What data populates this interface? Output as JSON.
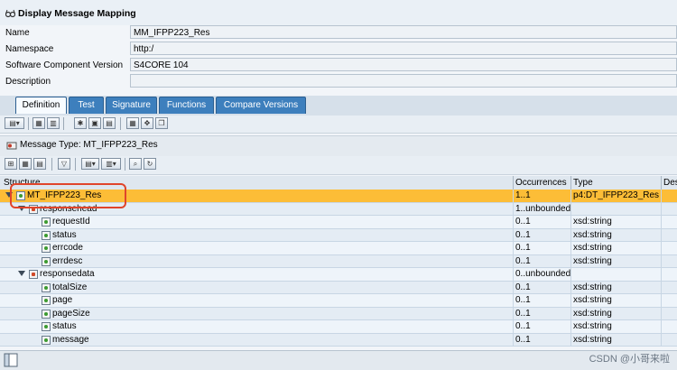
{
  "window": {
    "title": "Display Message Mapping"
  },
  "fields": [
    {
      "label": "Name",
      "value": "MM_IFPP223_Res"
    },
    {
      "label": "Namespace",
      "value": "http:/"
    },
    {
      "label": "Software Component Version",
      "value": "S4CORE 104"
    },
    {
      "label": "Description",
      "value": ""
    }
  ],
  "tabs": [
    "Definition",
    "Test",
    "Signature",
    "Functions",
    "Compare Versions"
  ],
  "message_type": {
    "label": "Message Type: MT_IFPP223_Res"
  },
  "grid": {
    "headers": {
      "structure": "Structure",
      "occurrences": "Occurrences",
      "type": "Type",
      "desc": "Des"
    },
    "rows": [
      {
        "name": "MT_IFPP223_Res",
        "occ": "1..1",
        "type": "p4:DT_IFPP223_Res"
      },
      {
        "name": "responsehead",
        "occ": "1..unbounded",
        "type": ""
      },
      {
        "name": "requestId",
        "occ": "0..1",
        "type": "xsd:string"
      },
      {
        "name": "status",
        "occ": "0..1",
        "type": "xsd:string"
      },
      {
        "name": "errcode",
        "occ": "0..1",
        "type": "xsd:string"
      },
      {
        "name": "errdesc",
        "occ": "0..1",
        "type": "xsd:string"
      },
      {
        "name": "responsedata",
        "occ": "0..unbounded",
        "type": ""
      },
      {
        "name": "totalSize",
        "occ": "0..1",
        "type": "xsd:string"
      },
      {
        "name": "page",
        "occ": "0..1",
        "type": "xsd:string"
      },
      {
        "name": "pageSize",
        "occ": "0..1",
        "type": "xsd:string"
      },
      {
        "name": "status",
        "occ": "0..1",
        "type": "xsd:string"
      },
      {
        "name": "message",
        "occ": "0..1",
        "type": "xsd:string"
      }
    ]
  },
  "watermark": "CSDN @小哥来啦"
}
